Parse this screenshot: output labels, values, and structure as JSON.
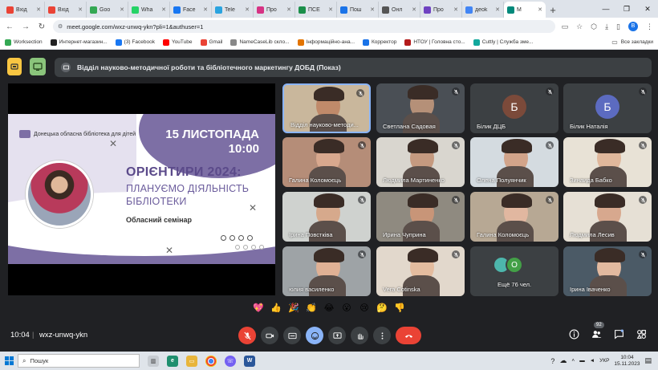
{
  "browser": {
    "tabs": [
      {
        "label": "Вхід",
        "color": "#ea4335"
      },
      {
        "label": "Вхід",
        "color": "#ea4335"
      },
      {
        "label": "Goo",
        "color": "#34a853"
      },
      {
        "label": "Wha",
        "color": "#25d366"
      },
      {
        "label": "Face",
        "color": "#1877f2"
      },
      {
        "label": "Tele",
        "color": "#2aa3df"
      },
      {
        "label": "Про",
        "color": "#d63384"
      },
      {
        "label": "ПСЕ",
        "color": "#1b8f4a"
      },
      {
        "label": "Пош",
        "color": "#1a73e8"
      },
      {
        "label": "Онл",
        "color": "#555555"
      },
      {
        "label": "Про",
        "color": "#6f42c1"
      },
      {
        "label": "дeok",
        "color": "#4285f4"
      },
      {
        "label": "M",
        "color": "#00897b",
        "active": true
      }
    ],
    "url": "meet.google.com/wxz-unwq-ykn?pli=1&authuser=1",
    "profile_letter": "В",
    "bookmarks": [
      {
        "label": "Worksection",
        "color": "#34a853"
      },
      {
        "label": "Интернет-магазин...",
        "color": "#222222"
      },
      {
        "label": "(3) Facebook",
        "color": "#1877f2"
      },
      {
        "label": "YouTube",
        "color": "#ff0000"
      },
      {
        "label": "Gmail",
        "color": "#ea4335"
      },
      {
        "label": "NameCaseLib скло...",
        "color": "#888888"
      },
      {
        "label": "Інформаційно-ана...",
        "color": "#e37400"
      },
      {
        "label": "Корректор",
        "color": "#1a73e8"
      },
      {
        "label": "НТОУ | Головна сто...",
        "color": "#b31b1b"
      },
      {
        "label": "Cuttly | Служба зме...",
        "color": "#12a89d"
      }
    ],
    "all_bookmarks": "Все закладки"
  },
  "meet": {
    "title": "Відділ науково-методичної роботи та бібліотечного маркетингу ДОБД (Показ)",
    "slide": {
      "library": "Донецька обласна бібліотека для дітей",
      "date_line1": "15 ЛИСТОПАДА",
      "date_line2": "10:00",
      "title1": "ОРІЄНТИРИ 2024:",
      "title2": "ПЛАНУЄМО ДІЯЛЬНІСТЬ",
      "title3": "БІБЛІОТЕКИ",
      "subtitle": "Обласний семінар"
    },
    "participants": [
      {
        "name": "Відділ науково-методи...",
        "kind": "photo",
        "bg": "#c9b79c",
        "skin": "#c08a6a",
        "active": true
      },
      {
        "name": "Светлана Садовая",
        "kind": "photo",
        "bg": "#4a4f55",
        "skin": "#b59078"
      },
      {
        "name": "Білик ДЦБ",
        "kind": "avatar",
        "letter": "Б",
        "color": "#7b4a3a"
      },
      {
        "name": "Білик Наталія",
        "kind": "avatar",
        "letter": "Б",
        "color": "#5c6bc0"
      },
      {
        "name": "Галина Коломоєць",
        "kind": "photo",
        "bg": "#b58d78",
        "skin": "#d8a88e"
      },
      {
        "name": "Людмила Мартиненко",
        "kind": "photo",
        "bg": "#d9d6cf",
        "skin": "#c59a80"
      },
      {
        "name": "Олена Полуянчик",
        "kind": "photo",
        "bg": "#d4dbe0",
        "skin": "#d2a48a"
      },
      {
        "name": "Зинаида Бабко",
        "kind": "photo",
        "bg": "#e8e2d6",
        "skin": "#e0b79b"
      },
      {
        "name": "Ірина Повстківа",
        "kind": "photo",
        "bg": "#cfd2cf",
        "skin": "#d6a98c"
      },
      {
        "name": "Ирина Чуприна",
        "kind": "photo",
        "bg": "#8f8a80",
        "skin": "#c89578"
      },
      {
        "name": "Галина Коломоєць",
        "kind": "photo",
        "bg": "#b7a894",
        "skin": "#e1b7a0"
      },
      {
        "name": "Людмила Лесив",
        "kind": "photo",
        "bg": "#e6e0d5",
        "skin": "#d7a88e"
      },
      {
        "name": "юлия василенко",
        "kind": "photo",
        "bg": "#9ea3a6",
        "skin": "#e0b195"
      },
      {
        "name": "Vera Cotinska",
        "kind": "photo",
        "bg": "#e2d8cc",
        "skin": "#e4bc9f"
      },
      {
        "name": "Ещё 76 чел.",
        "kind": "more",
        "letter": "О"
      },
      {
        "name": "Ірина Іваченко",
        "kind": "photo",
        "bg": "#4b5a66",
        "skin": "#e2b99f"
      }
    ],
    "reactions": [
      "💖",
      "👍",
      "🎉",
      "👏",
      "😂",
      "😮",
      "😢",
      "🤔",
      "👎"
    ],
    "time": "10:04",
    "separator": "|",
    "meeting_code": "wxz-unwq-ykn",
    "people_count": "92"
  },
  "taskbar": {
    "search_placeholder": "Пошук",
    "lang": "УКР",
    "clock_time": "10:04",
    "clock_date": "15.11.2023"
  }
}
